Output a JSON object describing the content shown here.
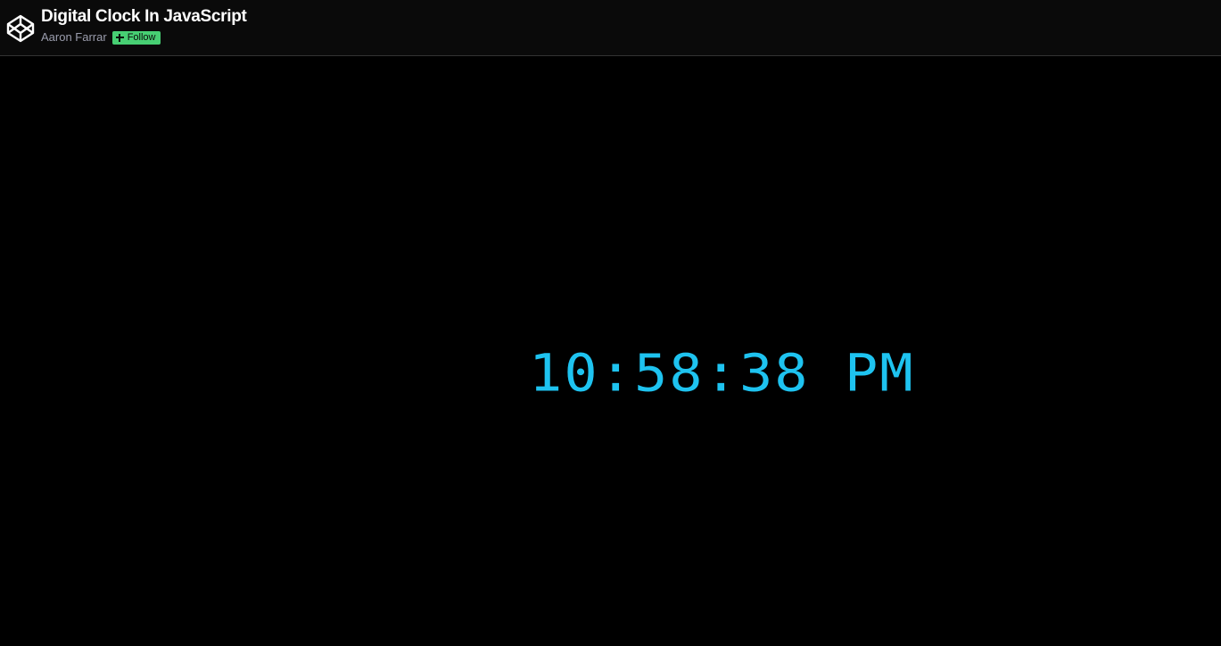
{
  "header": {
    "logo_icon": "codepen-logo-icon",
    "title": "Digital Clock In JavaScript",
    "author": "Aaron Farrar",
    "follow_label": "Follow",
    "follow_icon": "plus-icon"
  },
  "preview": {
    "clock_text": "10:58:38 PM"
  },
  "colors": {
    "header_bg": "#0a0a0a",
    "page_bg": "#000000",
    "title": "#ffffff",
    "author": "#9b9dad",
    "follow_bg": "#47cf73",
    "clock": "#1ec3f0"
  }
}
